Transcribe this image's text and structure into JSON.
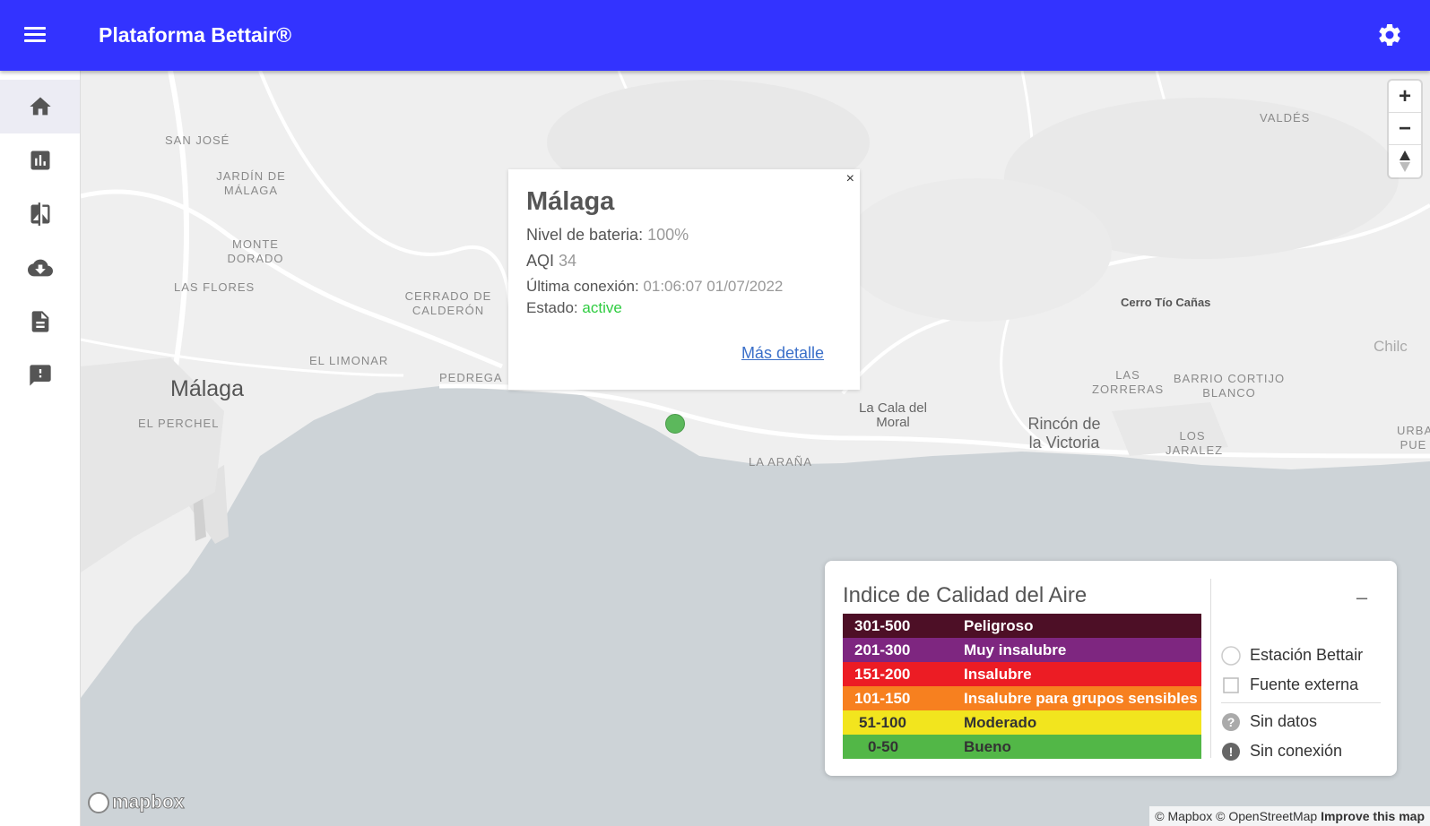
{
  "appbar": {
    "title": "Plataforma Bettair®",
    "menu_icon": "menu-icon",
    "settings_icon": "gear-icon"
  },
  "sidebar": {
    "items": [
      {
        "icon": "home-icon",
        "active": true
      },
      {
        "icon": "bar-chart-icon",
        "active": false
      },
      {
        "icon": "compare-icon",
        "active": false
      },
      {
        "icon": "cloud-download-icon",
        "active": false
      },
      {
        "icon": "document-icon",
        "active": false
      },
      {
        "icon": "feedback-icon",
        "active": false
      }
    ]
  },
  "map": {
    "places": [
      {
        "name": "SAN JOSÉ"
      },
      {
        "name": "JARDÍN DE MÁLAGA"
      },
      {
        "name": "MONTE DORADO"
      },
      {
        "name": "LAS FLORES"
      },
      {
        "name": "CERRADO DE CALDERÓN"
      },
      {
        "name": "EL LIMONAR"
      },
      {
        "name": "PEDREGA"
      },
      {
        "name": "Málaga"
      },
      {
        "name": "EL PERCHEL"
      },
      {
        "name": "VALDÉS"
      },
      {
        "name": "Cerro Tío Cañas"
      },
      {
        "name": "LAS ZORRERAS"
      },
      {
        "name": "BARRIO CORTIJO BLANCO"
      },
      {
        "name": "La Cala del Moral"
      },
      {
        "name": "Rincón de la Victoria"
      },
      {
        "name": "LOS JARALEZ"
      },
      {
        "name": "LA ARAÑA"
      },
      {
        "name": "Chilc"
      },
      {
        "name": "URBA PUE"
      }
    ],
    "attribution": "© Mapbox © OpenStreetMap",
    "improve": "Improve this map",
    "logo": "mapbox"
  },
  "popup": {
    "title": "Málaga",
    "battery_label": "Nivel de bateria:",
    "battery_value": "100%",
    "aqi_label": "AQI",
    "aqi_value": "34",
    "last_conn_label": "Última conexión:",
    "last_conn_value": "01:06:07 01/07/2022",
    "status_label": "Estado:",
    "status_value": "active",
    "more_link": "Más detalle",
    "close": "×"
  },
  "legend": {
    "title": "Indice de Calidad del Aire",
    "minimize": "–",
    "rows": [
      {
        "range": "301-500",
        "label": "Peligroso",
        "color": "#4d0f26"
      },
      {
        "range": "201-300",
        "label": "Muy insalubre",
        "color": "#7e2680"
      },
      {
        "range": "151-200",
        "label": "Insalubre",
        "color": "#ec1c24"
      },
      {
        "range": "101-150",
        "label": "Insalubre para grupos sensibles",
        "color": "#f7801f"
      },
      {
        "range": "51-100",
        "label": "Moderado",
        "color": "#f2e51e"
      },
      {
        "range": "0-50",
        "label": "Bueno",
        "color": "#52b747"
      }
    ],
    "symbols": [
      {
        "label": "Estación Bettair",
        "icon": "circle-icon"
      },
      {
        "label": "Fuente externa",
        "icon": "square-icon"
      },
      {
        "label": "Sin datos",
        "icon": "question-icon"
      },
      {
        "label": "Sin conexión",
        "icon": "alert-icon"
      }
    ]
  }
}
